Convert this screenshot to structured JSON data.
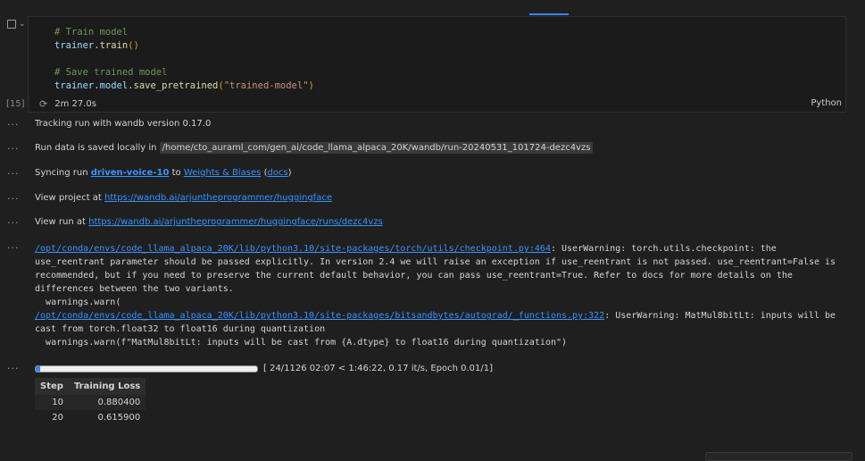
{
  "cell": {
    "execution_count": "[15]",
    "exec_time": "2m 27.0s",
    "language": "Python",
    "code": {
      "line1_comment": "# Train model",
      "line2_obj": "trainer",
      "line2_fn": "train",
      "line4_comment": "# Save trained model",
      "line5_obj": "trainer",
      "line5_attr": "model",
      "line5_fn": "save_pretrained",
      "line5_arg": "\"trained-model\""
    }
  },
  "output": {
    "dots": "···",
    "tracking": "Tracking run with wandb version 0.17.0",
    "run_data_prefix": "Run data is saved locally in",
    "run_data_path": "/home/cto_auraml_com/gen_ai/code_llama_alpaca_20K/wandb/run-20240531_101724-dezc4vzs",
    "syncing_prefix": "Syncing run",
    "run_name": "driven-voice-10",
    "syncing_to": "to",
    "wandb_link": "Weights & Biases",
    "docs_open": "(",
    "docs_link": "docs",
    "docs_close": ")",
    "view_project_prefix": "View project at",
    "project_url": "https://wandb.ai/arjuntheprogrammer/huggingface",
    "view_run_prefix": "View run at",
    "run_url": "https://wandb.ai/arjuntheprogrammer/huggingface/runs/dezc4vzs",
    "warn_path1": "/opt/conda/envs/code_llama_alpaca_20K/lib/python3.10/site-packages/torch/utils/checkpoint.py:464",
    "warn_text1": ": UserWarning: torch.utils.checkpoint: the use_reentrant parameter should be passed explicitly. In version 2.4 we will raise an exception if use_reentrant is not passed. use_reentrant=False is recommended, but if you need to preserve the current default behavior, you can pass use_reentrant=True. Refer to docs for more details on the differences between the two variants.\n  warnings.warn(\n",
    "warn_path2": "/opt/conda/envs/code_llama_alpaca_20K/lib/python3.10/site-packages/bitsandbytes/autograd/_functions.py:322",
    "warn_text2": ": UserWarning: MatMul8bitLt: inputs will be cast from torch.float32 to float16 during quantization\n  warnings.warn(f\"MatMul8bitLt: inputs will be cast from {A.dtype} to float16 during quantization\")",
    "progress_fraction": 0.0213,
    "progress_text": "[ 24/1126 02:07 < 1:46:22, 0.17 it/s, Epoch 0.01/1]",
    "table": {
      "headers": [
        "Step",
        "Training Loss"
      ],
      "rows": [
        [
          "10",
          "0.880400"
        ],
        [
          "20",
          "0.615900"
        ]
      ]
    }
  },
  "colors": {
    "accent": "#3b82f6",
    "link": "#3794ff",
    "background": "#1f1f1f"
  }
}
